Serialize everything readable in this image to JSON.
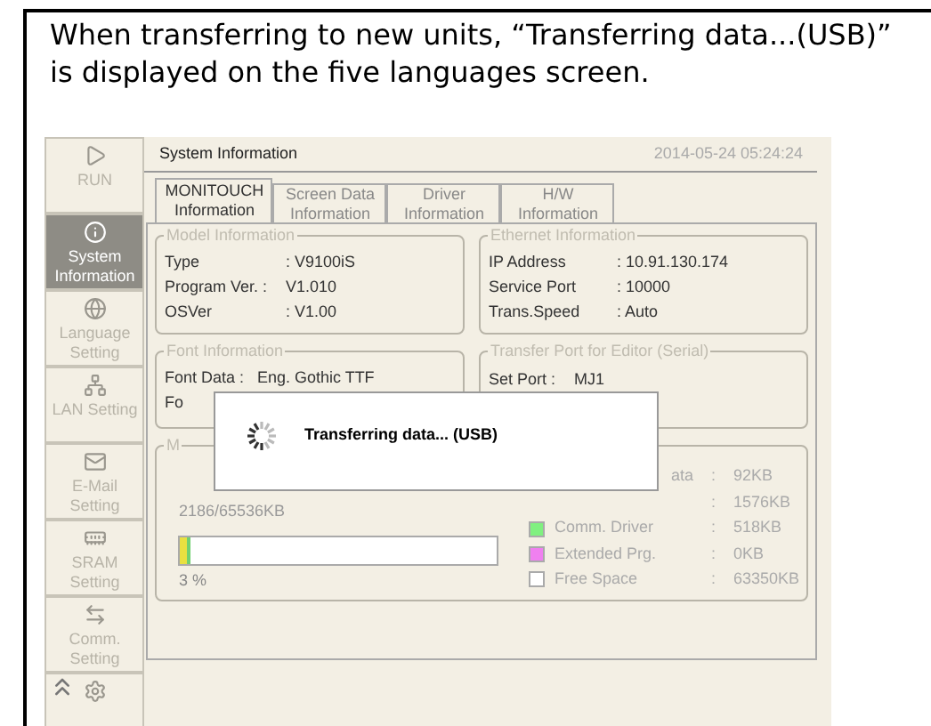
{
  "caption": "When transferring to new units, “Transferring data...(USB)” is displayed on the five languages screen.",
  "sidebar": {
    "items": [
      {
        "kind": "run",
        "label": "RUN",
        "selected": false
      },
      {
        "kind": "info",
        "label": "System Information",
        "selected": true
      },
      {
        "kind": "language",
        "label": "Language Setting",
        "selected": false
      },
      {
        "kind": "lan",
        "label": "LAN Setting",
        "selected": false
      },
      {
        "kind": "mail",
        "label": "E-Mail Setting",
        "selected": false
      },
      {
        "kind": "sram",
        "label": "SRAM Setting",
        "selected": false
      },
      {
        "kind": "comm",
        "label": "Comm. Setting",
        "selected": false
      },
      {
        "kind": "gear",
        "selected": false
      }
    ]
  },
  "header": {
    "title": "System Information",
    "datetime": "2014-05-24 05:24:24"
  },
  "tabs": [
    {
      "label": "MONITOUCH Information",
      "selected": true
    },
    {
      "label": "Screen Data Information",
      "selected": false
    },
    {
      "label": "Driver Information",
      "selected": false
    },
    {
      "label": "H/W Information",
      "selected": false
    }
  ],
  "model_info": {
    "title": "Model Information",
    "rows": [
      {
        "label": "Type",
        "value": ": V9100iS"
      },
      {
        "label": "Program Ver. :",
        "value": "V1.010"
      },
      {
        "label": "OSVer",
        "value": ": V1.00"
      }
    ]
  },
  "ethernet_info": {
    "title": "Ethernet Information",
    "rows": [
      {
        "label": "IP Address",
        "value": ":  10.91.130.174"
      },
      {
        "label": "Service Port",
        "value": ":  10000"
      },
      {
        "label": "Trans.Speed",
        "value": ":  Auto"
      }
    ]
  },
  "font_info": {
    "title": "Font Information",
    "rows": [
      {
        "label": "Font Data :",
        "value": "Eng. Gothic TTF"
      },
      {
        "label": "Fo"
      }
    ]
  },
  "transfer_port": {
    "title": "Transfer Port for Editor (Serial)",
    "rows": [
      {
        "label": "Set Port :",
        "value": "MJ1"
      }
    ]
  },
  "memory": {
    "title": "M",
    "usage": "2186/65536KB",
    "level": 0.03,
    "percent": "3 %",
    "legend": [
      {
        "label": "ata",
        "value": ":    92KB"
      },
      {
        "value": ":    1576KB"
      },
      {
        "label": "Comm. Driver",
        "value": ":    518KB",
        "color": "#80f080"
      },
      {
        "label": "Extended Prg.",
        "value": ":    0KB",
        "color": "#f080f0"
      },
      {
        "label": "Free Space",
        "value": ":    63350KB",
        "color": "#ffffff"
      }
    ]
  },
  "dialog": {
    "message": "Transferring data... (USB)"
  }
}
